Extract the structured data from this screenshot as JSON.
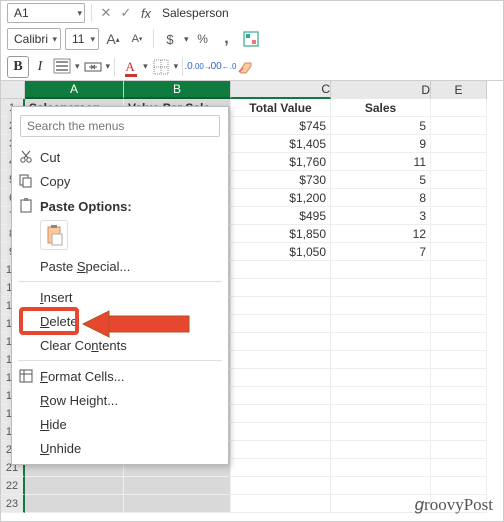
{
  "namebox": {
    "cell_ref": "A1",
    "formula_value": "Salesperson"
  },
  "font": {
    "name": "Calibri",
    "size": "11"
  },
  "columns": {
    "A": "A",
    "B": "B",
    "C": "C",
    "D": "D",
    "E": "E",
    "headers": {
      "A": "Salesperson",
      "B": "Value Per Sale",
      "C": "Total Value",
      "D": "Sales"
    }
  },
  "rows": [
    {
      "C": "$745",
      "D": "5"
    },
    {
      "C": "$1,405",
      "D": "9"
    },
    {
      "C": "$1,760",
      "D": "11"
    },
    {
      "C": "$730",
      "D": "5"
    },
    {
      "C": "$1,200",
      "D": "8"
    },
    {
      "C": "$495",
      "D": "3"
    },
    {
      "C": "$1,850",
      "D": "12"
    },
    {
      "C": "$1,050",
      "D": "7"
    }
  ],
  "context_menu": {
    "search_placeholder": "Search the menus",
    "cut": "Cut",
    "copy": "Copy",
    "paste_options": "Paste Options:",
    "paste_special": "Paste Special...",
    "insert": "Insert",
    "delete": "Delete",
    "clear_contents": "Clear Contents",
    "format_cells": "Format Cells...",
    "row_height": "Row Height...",
    "hide": "Hide",
    "unhide": "Unhide"
  },
  "watermark": "groovyPost",
  "icons": {
    "increase_font": "A",
    "decrease_font": "A",
    "currency": "$",
    "percent": "%",
    "comma": ","
  }
}
